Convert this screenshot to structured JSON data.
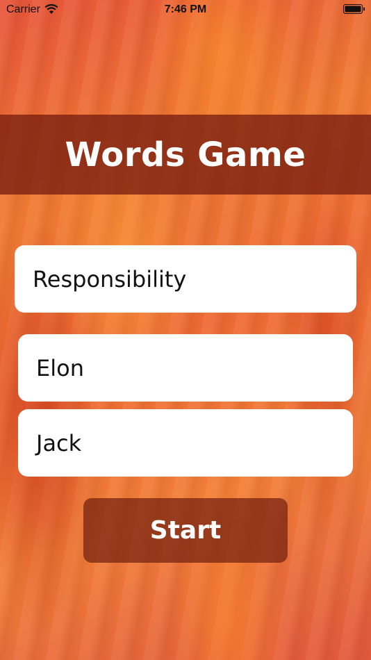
{
  "status_bar": {
    "carrier": "Carrier",
    "time": "7:46 PM",
    "wifi_icon": "wifi-icon",
    "battery_icon": "battery-icon"
  },
  "header": {
    "title": "Words Game"
  },
  "form": {
    "word_value": "Responsibility",
    "player1_value": "Elon",
    "player2_value": "Jack"
  },
  "actions": {
    "start_label": "Start"
  },
  "colors": {
    "background_primary": "#f07a32",
    "banner": "#781e0f",
    "button": "#73200f",
    "field": "#ffffff",
    "text_light": "#ffffff"
  }
}
